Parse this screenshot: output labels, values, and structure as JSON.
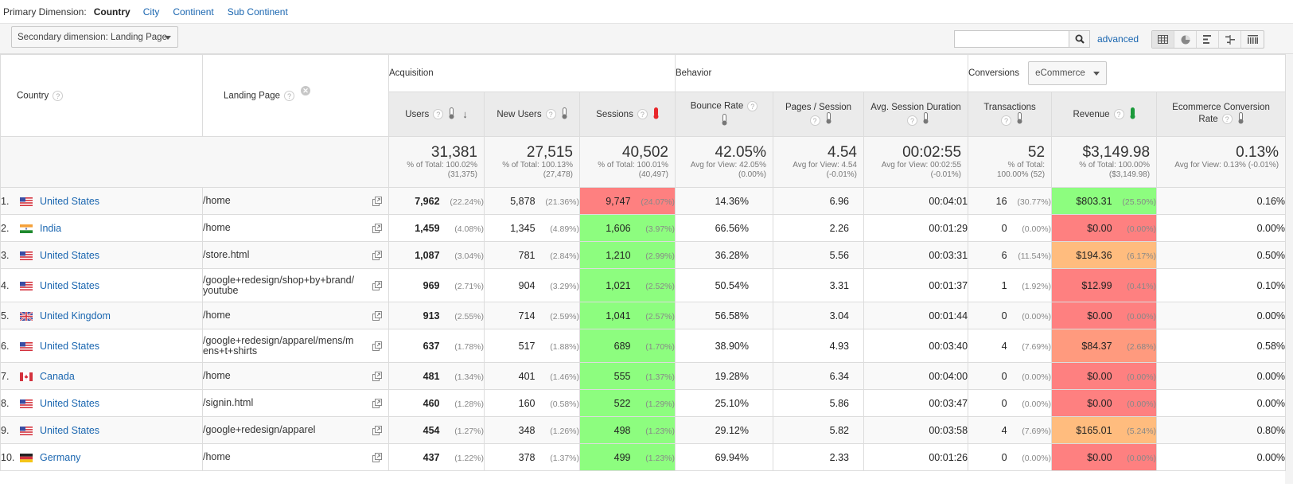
{
  "primary_dimension": {
    "label": "Primary Dimension:",
    "active": "Country",
    "options": [
      "City",
      "Continent",
      "Sub Continent"
    ]
  },
  "toolbar": {
    "secondary_dimension": "Secondary dimension: Landing Page",
    "search_value": "",
    "advanced_label": "advanced",
    "views": [
      "table-view",
      "pie-view",
      "performance-view",
      "comparison-view",
      "pivot-view"
    ],
    "active_view": "table-view"
  },
  "columns": {
    "country": "Country",
    "landing_page": "Landing Page",
    "groups": {
      "acquisition": "Acquisition",
      "behavior": "Behavior",
      "conversions": "Conversions"
    },
    "conversions_select": "eCommerce",
    "users": "Users",
    "new_users": "New Users",
    "sessions": "Sessions",
    "bounce_rate": "Bounce Rate",
    "pages_session": "Pages / Session",
    "avg_duration": "Avg. Session Duration",
    "transactions": "Transactions",
    "revenue": "Revenue",
    "ecom_rate_line1": "Ecommerce Conversion",
    "ecom_rate_line2": "Rate"
  },
  "colors": {
    "link": "#1a66b0",
    "heat_red": "#fe8080",
    "heat_green": "#8dfd7f",
    "heat_orange": "#ffbc7e",
    "heat_salmon": "#ff9a7e",
    "thermo_sessions": "#e8262a",
    "thermo_revenue": "#1b9a3b"
  },
  "totals": {
    "users": {
      "value": "31,381",
      "sub1": "% of Total: 100.02%",
      "sub2": "(31,375)"
    },
    "new_users": {
      "value": "27,515",
      "sub1": "% of Total: 100.13%",
      "sub2": "(27,478)"
    },
    "sessions": {
      "value": "40,502",
      "sub1": "% of Total: 100.01%",
      "sub2": "(40,497)"
    },
    "bounce_rate": {
      "value": "42.05%",
      "sub1": "Avg for View: 42.05%",
      "sub2": "(0.00%)"
    },
    "pages_session": {
      "value": "4.54",
      "sub1": "Avg for View: 4.54",
      "sub2": "(-0.01%)"
    },
    "avg_duration": {
      "value": "00:02:55",
      "sub1": "Avg for View: 00:02:55",
      "sub2": "(-0.01%)"
    },
    "transactions": {
      "value": "52",
      "sub1": "% of Total:",
      "sub2": "100.00% (52)"
    },
    "revenue": {
      "value": "$3,149.98",
      "sub1": "% of Total: 100.00%",
      "sub2": "($3,149.98)"
    },
    "ecom_rate": {
      "value": "0.13%",
      "sub1": "Avg for View: 0.13% (-0.01%)",
      "sub2": ""
    }
  },
  "rows": [
    {
      "idx": "1.",
      "flag": "us",
      "country": "United States",
      "landing": "/home",
      "users": "7,962",
      "users_pct": "(22.24%)",
      "new_users": "5,878",
      "new_users_pct": "(21.36%)",
      "sessions": "9,747",
      "sessions_pct": "(24.07%)",
      "sessions_heat": "red",
      "bounce": "14.36%",
      "pps": "6.96",
      "dur": "00:04:01",
      "trans": "16",
      "trans_pct": "(30.77%)",
      "revenue": "$803.31",
      "revenue_pct": "(25.50%)",
      "revenue_heat": "green",
      "ecom": "0.16%"
    },
    {
      "idx": "2.",
      "flag": "in",
      "country": "India",
      "landing": "/home",
      "users": "1,459",
      "users_pct": "(4.08%)",
      "new_users": "1,345",
      "new_users_pct": "(4.89%)",
      "sessions": "1,606",
      "sessions_pct": "(3.97%)",
      "sessions_heat": "green",
      "bounce": "66.56%",
      "pps": "2.26",
      "dur": "00:01:29",
      "trans": "0",
      "trans_pct": "(0.00%)",
      "revenue": "$0.00",
      "revenue_pct": "(0.00%)",
      "revenue_heat": "red",
      "ecom": "0.00%"
    },
    {
      "idx": "3.",
      "flag": "us",
      "country": "United States",
      "landing": "/store.html",
      "users": "1,087",
      "users_pct": "(3.04%)",
      "new_users": "781",
      "new_users_pct": "(2.84%)",
      "sessions": "1,210",
      "sessions_pct": "(2.99%)",
      "sessions_heat": "green",
      "bounce": "36.28%",
      "pps": "5.56",
      "dur": "00:03:31",
      "trans": "6",
      "trans_pct": "(11.54%)",
      "revenue": "$194.36",
      "revenue_pct": "(6.17%)",
      "revenue_heat": "orange",
      "ecom": "0.50%"
    },
    {
      "idx": "4.",
      "flag": "us",
      "country": "United States",
      "landing": "/google+redesign/shop+by+brand/youtube",
      "users": "969",
      "users_pct": "(2.71%)",
      "new_users": "904",
      "new_users_pct": "(3.29%)",
      "sessions": "1,021",
      "sessions_pct": "(2.52%)",
      "sessions_heat": "green",
      "bounce": "50.54%",
      "pps": "3.31",
      "dur": "00:01:37",
      "trans": "1",
      "trans_pct": "(1.92%)",
      "revenue": "$12.99",
      "revenue_pct": "(0.41%)",
      "revenue_heat": "red",
      "ecom": "0.10%"
    },
    {
      "idx": "5.",
      "flag": "gb",
      "country": "United Kingdom",
      "landing": "/home",
      "users": "913",
      "users_pct": "(2.55%)",
      "new_users": "714",
      "new_users_pct": "(2.59%)",
      "sessions": "1,041",
      "sessions_pct": "(2.57%)",
      "sessions_heat": "green",
      "bounce": "56.58%",
      "pps": "3.04",
      "dur": "00:01:44",
      "trans": "0",
      "trans_pct": "(0.00%)",
      "revenue": "$0.00",
      "revenue_pct": "(0.00%)",
      "revenue_heat": "red",
      "ecom": "0.00%"
    },
    {
      "idx": "6.",
      "flag": "us",
      "country": "United States",
      "landing": "/google+redesign/apparel/mens/mens+t+shirts",
      "users": "637",
      "users_pct": "(1.78%)",
      "new_users": "517",
      "new_users_pct": "(1.88%)",
      "sessions": "689",
      "sessions_pct": "(1.70%)",
      "sessions_heat": "green",
      "bounce": "38.90%",
      "pps": "4.93",
      "dur": "00:03:40",
      "trans": "4",
      "trans_pct": "(7.69%)",
      "revenue": "$84.37",
      "revenue_pct": "(2.68%)",
      "revenue_heat": "salmon",
      "ecom": "0.58%"
    },
    {
      "idx": "7.",
      "flag": "ca",
      "country": "Canada",
      "landing": "/home",
      "users": "481",
      "users_pct": "(1.34%)",
      "new_users": "401",
      "new_users_pct": "(1.46%)",
      "sessions": "555",
      "sessions_pct": "(1.37%)",
      "sessions_heat": "green",
      "bounce": "19.28%",
      "pps": "6.34",
      "dur": "00:04:00",
      "trans": "0",
      "trans_pct": "(0.00%)",
      "revenue": "$0.00",
      "revenue_pct": "(0.00%)",
      "revenue_heat": "red",
      "ecom": "0.00%"
    },
    {
      "idx": "8.",
      "flag": "us",
      "country": "United States",
      "landing": "/signin.html",
      "users": "460",
      "users_pct": "(1.28%)",
      "new_users": "160",
      "new_users_pct": "(0.58%)",
      "sessions": "522",
      "sessions_pct": "(1.29%)",
      "sessions_heat": "green",
      "bounce": "25.10%",
      "pps": "5.86",
      "dur": "00:03:47",
      "trans": "0",
      "trans_pct": "(0.00%)",
      "revenue": "$0.00",
      "revenue_pct": "(0.00%)",
      "revenue_heat": "red",
      "ecom": "0.00%"
    },
    {
      "idx": "9.",
      "flag": "us",
      "country": "United States",
      "landing": "/google+redesign/apparel",
      "users": "454",
      "users_pct": "(1.27%)",
      "new_users": "348",
      "new_users_pct": "(1.26%)",
      "sessions": "498",
      "sessions_pct": "(1.23%)",
      "sessions_heat": "green",
      "bounce": "29.12%",
      "pps": "5.82",
      "dur": "00:03:58",
      "trans": "4",
      "trans_pct": "(7.69%)",
      "revenue": "$165.01",
      "revenue_pct": "(5.24%)",
      "revenue_heat": "orange",
      "ecom": "0.80%"
    },
    {
      "idx": "10.",
      "flag": "de",
      "country": "Germany",
      "landing": "/home",
      "users": "437",
      "users_pct": "(1.22%)",
      "new_users": "378",
      "new_users_pct": "(1.37%)",
      "sessions": "499",
      "sessions_pct": "(1.23%)",
      "sessions_heat": "green",
      "bounce": "69.94%",
      "pps": "2.33",
      "dur": "00:01:26",
      "trans": "0",
      "trans_pct": "(0.00%)",
      "revenue": "$0.00",
      "revenue_pct": "(0.00%)",
      "revenue_heat": "red",
      "ecom": "0.00%"
    }
  ]
}
